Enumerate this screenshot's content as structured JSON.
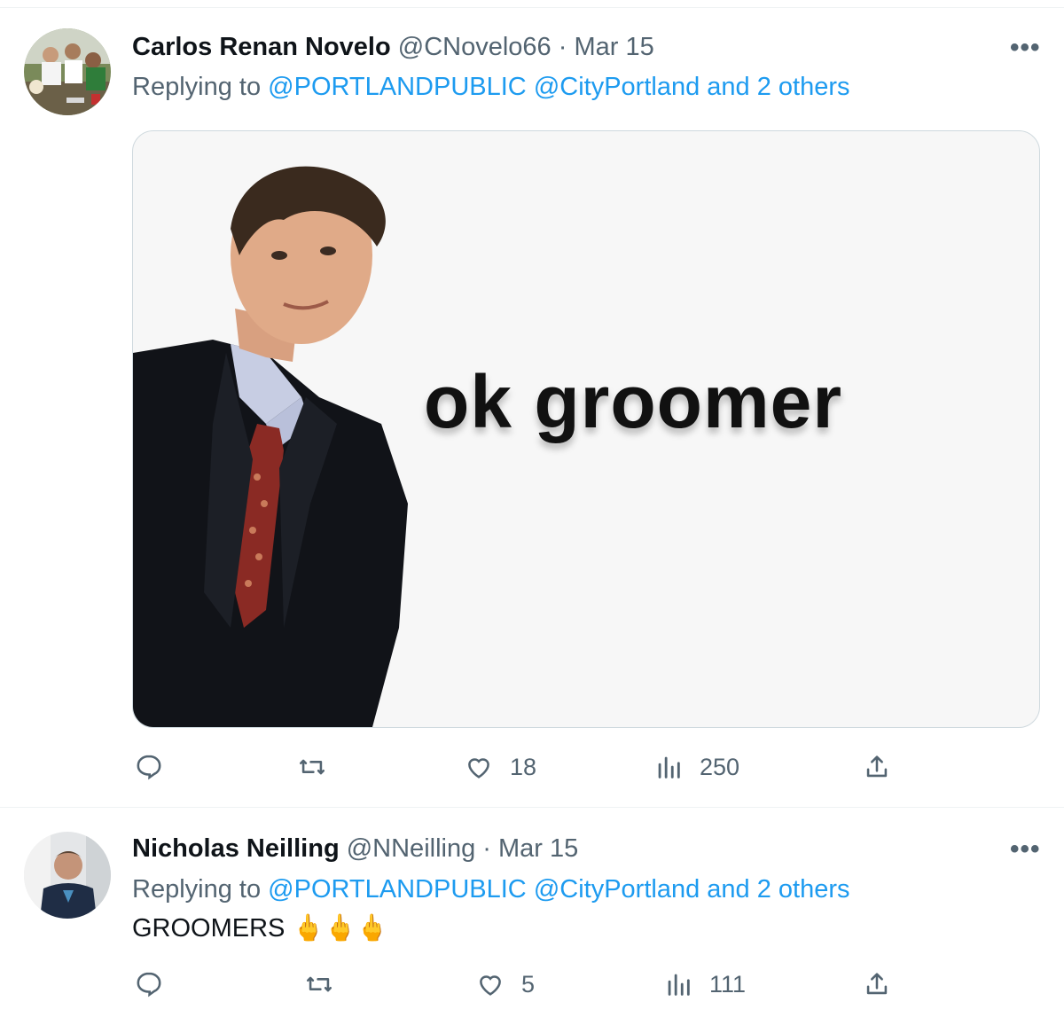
{
  "tweets": [
    {
      "display_name": "Carlos Renan Novelo",
      "handle": "@CNovelo66",
      "dot": "·",
      "time": "Mar 15",
      "replying_prefix": "Replying to",
      "mentions": [
        "@PORTLANDPUBLIC",
        "@CityPortland",
        "and 2 others"
      ],
      "media_caption": "ok groomer",
      "more_label": "•••",
      "stats": {
        "replies": "",
        "retweets": "",
        "likes": "18",
        "views": "250"
      }
    },
    {
      "display_name": "Nicholas Neilling",
      "handle": "@NNeilling",
      "dot": "·",
      "time": "Mar 15",
      "replying_prefix": "Replying to",
      "mentions": [
        "@PORTLANDPUBLIC",
        "@CityPortland",
        "and 2 others"
      ],
      "text": "GROOMERS",
      "emoji": "🖕🖕🖕",
      "more_label": "•••",
      "stats": {
        "replies": "",
        "retweets": "",
        "likes": "5",
        "views": "111"
      }
    }
  ],
  "colors": {
    "text_primary": "#0f1419",
    "text_secondary": "#536471",
    "link": "#1d9bf0",
    "divider": "#eff3f4"
  },
  "icons": [
    "reply-icon",
    "retweet-icon",
    "like-icon",
    "views-icon",
    "share-icon",
    "more-icon"
  ]
}
